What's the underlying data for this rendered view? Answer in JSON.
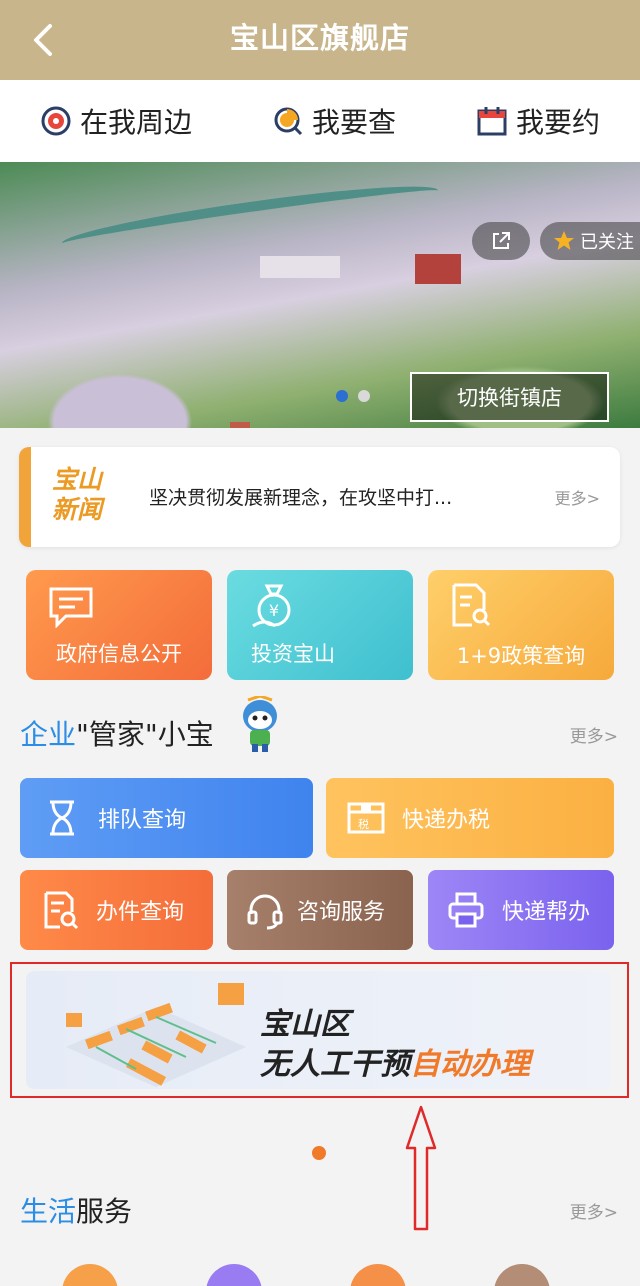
{
  "header": {
    "title": "宝山区旗舰店"
  },
  "quicknav": [
    {
      "label": "在我周边",
      "icon": "location-target-icon"
    },
    {
      "label": "我要查",
      "icon": "search-query-icon"
    },
    {
      "label": "我要约",
      "icon": "calendar-icon"
    }
  ],
  "banner": {
    "follow_label": "已关注",
    "switch_label": "切换街镇店"
  },
  "news": {
    "logo": "宝山新闻",
    "headline": "坚决贯彻发展新理念，在攻坚中打...",
    "more": "更多>"
  },
  "tiles": [
    {
      "label": "政府信息公开",
      "icon": "message-board-icon"
    },
    {
      "label": "投资宝山",
      "icon": "money-bag-icon"
    },
    {
      "label": "1+9政策查询",
      "icon": "document-search-icon"
    }
  ],
  "enterprise": {
    "title_blue": "企业",
    "title_rest": "\"管家\"小宝",
    "more": "更多>"
  },
  "services": [
    {
      "label": "排队查询",
      "icon": "hourglass-icon"
    },
    {
      "label": "快递办税",
      "icon": "tax-box-icon"
    },
    {
      "label": "办件查询",
      "icon": "file-search-icon"
    },
    {
      "label": "咨询服务",
      "icon": "headset-icon"
    },
    {
      "label": "快递帮办",
      "icon": "printer-icon"
    }
  ],
  "promo": {
    "line1": "宝山区",
    "line2_prefix": "无人工干预",
    "line2_highlight": "自动办理"
  },
  "life": {
    "title_blue": "生活",
    "title_rest": "服务",
    "more": "更多>"
  },
  "colors": {
    "header": "#c8b58b",
    "accent_blue": "#2b8de6",
    "accent_orange": "#f07a2a",
    "highlight_frame": "#e02a2a"
  }
}
